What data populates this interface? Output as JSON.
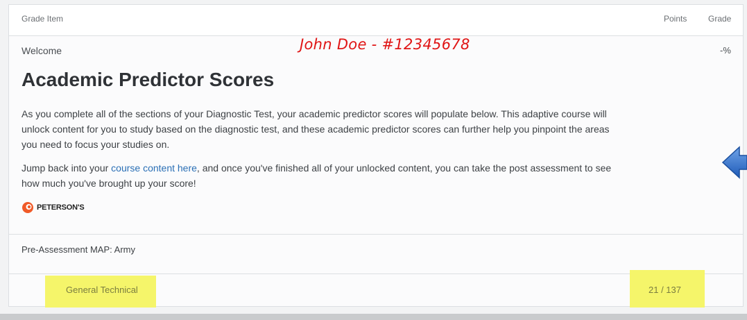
{
  "table": {
    "header": {
      "grade_item": "Grade Item",
      "points": "Points",
      "grade": "Grade"
    },
    "welcome": {
      "label": "Welcome",
      "grade": "-%"
    },
    "pre_assessment": {
      "label": "Pre-Assessment MAP: Army"
    },
    "general_technical": {
      "label": "General Technical",
      "score": "21 / 137"
    }
  },
  "annotation": {
    "text": "John Doe - #12345678",
    "color": "#e01515"
  },
  "content": {
    "title": "Academic Predictor Scores",
    "para1": "As you complete all of the sections of your Diagnostic Test, your academic predictor scores will populate below. This adaptive course will unlock content for you to study based on the diagnostic test, and these academic predictor scores can further help you pinpoint the areas you need to focus your studies on.",
    "para2_before": "Jump back into your ",
    "para2_link": "course content here",
    "para2_after": ", and once you've finished all of your unlocked content, you can take the post assessment to see how much you've brought up your score!",
    "logo_text": "PETERSON'S"
  },
  "colors": {
    "highlight": "#f5f56a",
    "link": "#2a6fb5",
    "arrow": "#2f6fc9"
  },
  "icons": {
    "logo": "petersons-logo-icon",
    "arrow": "left-arrow-icon"
  }
}
